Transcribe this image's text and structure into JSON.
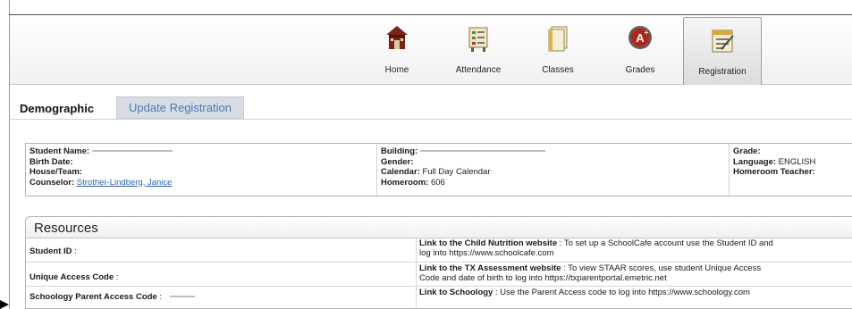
{
  "nav": {
    "items": [
      {
        "label": "Home",
        "icon": "home-icon"
      },
      {
        "label": "Attendance",
        "icon": "attendance-icon"
      },
      {
        "label": "Classes",
        "icon": "classes-icon"
      },
      {
        "label": "Grades",
        "icon": "grades-icon"
      },
      {
        "label": "Registration",
        "icon": "registration-icon"
      }
    ],
    "active": "Registration"
  },
  "tabs": {
    "demographic": "Demographic",
    "update_registration": "Update Registration"
  },
  "student": {
    "name_label": "Student Name:",
    "birth_label": "Birth Date:",
    "house_label": "House/Team:",
    "counselor_label": "Counselor:",
    "counselor_value": "Strother-Lindberg, Janice",
    "building_label": "Building:",
    "gender_label": "Gender:",
    "calendar_label": "Calendar:",
    "calendar_value": "Full Day Calendar",
    "homeroom_label": "Homeroom:",
    "homeroom_value": "606",
    "grade_label": "Grade:",
    "language_label": "Language:",
    "language_value": "ENGLISH",
    "homeroom_teacher_label": "Homeroom Teacher:"
  },
  "resources": {
    "title": "Resources",
    "rows": [
      {
        "left_label": "Student ID",
        "link_title": "Link to the Child Nutrition website",
        "link_text": " : To set up a SchoolCafe account use the Student ID and",
        "link_text2": "log into https://www.schoolcafe.com"
      },
      {
        "left_label": "Unique Access Code",
        "link_title": "Link to the TX Assessment website",
        "link_text": " : To view STAAR scores, use student Unique Access",
        "link_text2": "Code and date of birth to log into https://txparentportal.emetric.net"
      },
      {
        "left_label": "Schoology Parent Access Code",
        "link_title": "Link to Schoology",
        "link_text": " : Use the Parent Access code to log into https://www.schoology.com",
        "link_text2": ""
      }
    ]
  },
  "colors": {
    "tab_update_bg": "#d8dde3",
    "tab_update_text": "#4b78b3",
    "link": "#2f5fae"
  }
}
